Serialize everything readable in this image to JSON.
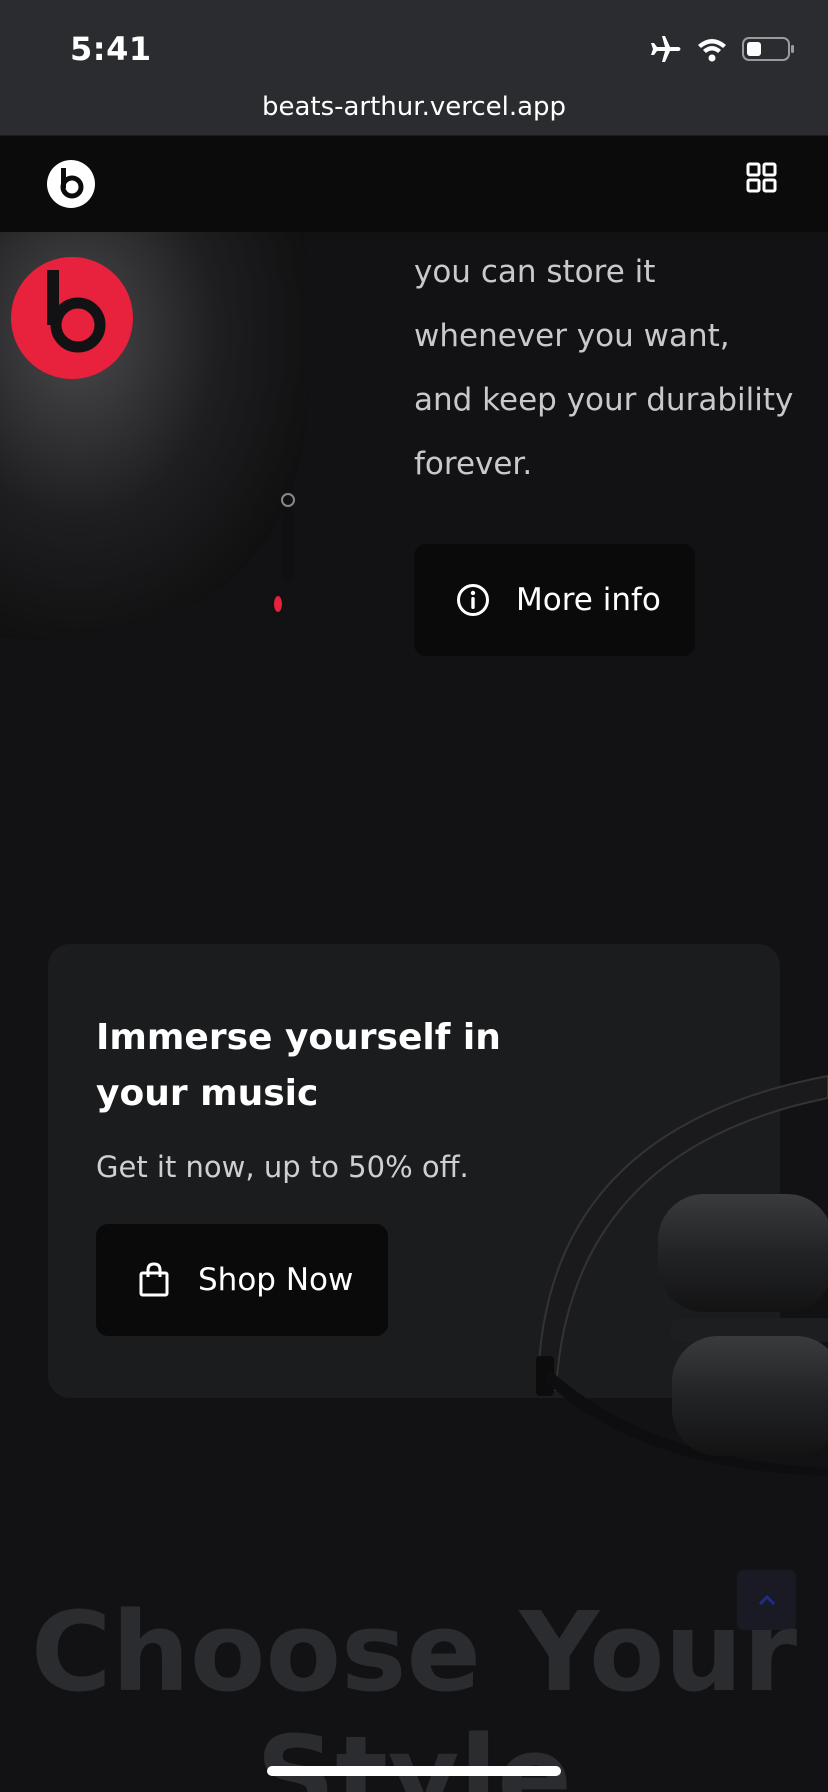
{
  "status_bar": {
    "time": "5:41",
    "url": "beats-arthur.vercel.app"
  },
  "header": {
    "logo_icon": "beats-logo-icon",
    "menu_icon": "grid-icon"
  },
  "hero": {
    "text_lines": [
      "you can store it",
      "whenever you want,",
      "and keep your durability",
      "forever."
    ],
    "more_info_label": "More info",
    "more_info_icon": "info-icon"
  },
  "promo": {
    "title": "Immerse yourself in your music",
    "subtitle": "Get it now, up to 50% off.",
    "shop_label": "Shop Now",
    "shop_icon": "shopping-bag-icon"
  },
  "section": {
    "heading": "Choose Your Style"
  },
  "colors": {
    "accent": "#e8213d",
    "background": "#121214",
    "card": "#1b1c1e",
    "button": "#0a0a0b"
  }
}
